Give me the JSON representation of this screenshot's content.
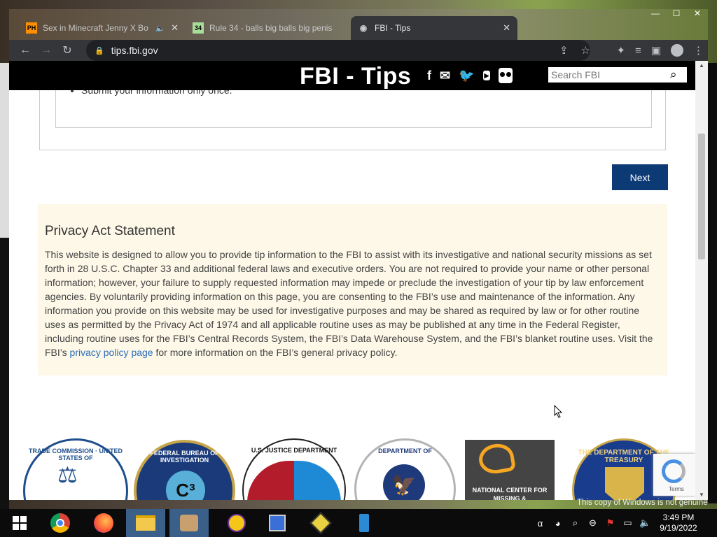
{
  "browser": {
    "tabs": [
      {
        "label": "Sex in Minecraft Jenny X Bo",
        "icon": "pornhub-favicon",
        "active": false
      },
      {
        "label": "Rule 34 - balls big balls big penis",
        "icon": "rule34-favicon",
        "active": false
      },
      {
        "label": "FBI - Tips",
        "icon": "fbi-favicon",
        "active": true
      }
    ],
    "url": "tips.fbi.gov"
  },
  "header": {
    "title": "FBI - Tips",
    "search_placeholder": "Search FBI",
    "social": [
      "facebook-icon",
      "email-icon",
      "twitter-icon",
      "youtube-icon",
      "flickr-icon"
    ],
    "youtube_label": "You\nTube"
  },
  "form": {
    "bullet": "Submit your information only once.",
    "next_label": "Next"
  },
  "privacy": {
    "heading": "Privacy Act Statement",
    "body_before_link": "This website is designed to allow you to provide tip information to the FBI to assist with its investigative and national security missions as set forth in 28 U.S.C. Chapter 33 and additional federal laws and executive orders. You are not required to provide your name or other personal information; however, your failure to supply requested information may impede or preclude the investigation of your tip by law enforcement agencies. By voluntarily providing information on this page, you are consenting to the FBI’s use and maintenance of the information. Any information you provide on this website may be used for investigative purposes and may be shared as required by law or for other routine uses as permitted by the Privacy Act of 1974 and all applicable routine uses as may be published at any time in the Federal Register, including routine uses for the FBI’s Central Records System, the FBI’s Data Warehouse System, and the FBI’s blanket routine uses. Visit the FBI’s ",
    "link_text": "privacy policy page",
    "body_after_link": " for more information on the FBI’s general privacy policy."
  },
  "seals": [
    {
      "name": "ftc-seal",
      "text": "TRADE COMMISSION · UNITED STATES OF"
    },
    {
      "name": "fbi-c3-seal",
      "text": "FEDERAL BUREAU OF INVESTIGATION"
    },
    {
      "name": "doj-seal",
      "text": "U.S. JUSTICE DEPARTMENT"
    },
    {
      "name": "dhs-seal",
      "text": "DEPARTMENT OF"
    },
    {
      "name": "ncmec-logo",
      "text": "NATIONAL CENTER FOR\nMISSING &"
    },
    {
      "name": "treasury-seal",
      "text": "THE DEPARTMENT OF THE TREASURY"
    }
  ],
  "recaptcha": {
    "terms": "Terms"
  },
  "watermark": "This copy of Windows is not genuine",
  "taskbar": {
    "time": "3:49 PM",
    "date": "9/19/2022",
    "apps": [
      "windows-start-icon",
      "chrome-icon",
      "firefox-icon",
      "file-explorer-icon",
      "paint-icon",
      "yahoo-messenger-icon",
      "network-icon",
      "app-icon",
      "phone-icon"
    ]
  }
}
